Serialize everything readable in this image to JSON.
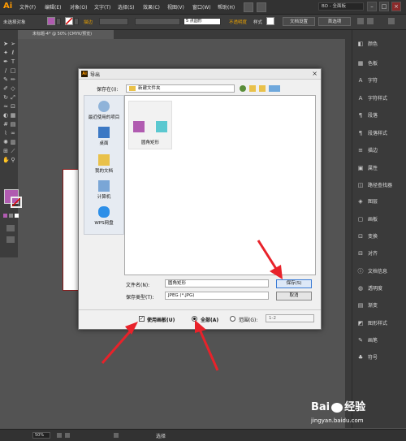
{
  "app": {
    "logo": "Ai"
  },
  "menubar": {
    "items": [
      "文件(F)",
      "编辑(E)",
      "对象(O)",
      "文字(T)",
      "选择(S)",
      "效果(C)",
      "视图(V)",
      "窗口(W)",
      "帮助(H)"
    ],
    "workspace": "BO - 全面板"
  },
  "controlbar": {
    "no_selection": "未选择对象",
    "stroke_label": "描边",
    "brush_value": "5 点圆形",
    "opacity_label": "不透明度",
    "style_label": "样式",
    "doc_setup": "文档设置",
    "preferences": "首选项"
  },
  "document": {
    "tab_title": "未标题-4* @ 50% (CMYK/预览)"
  },
  "right_panel": {
    "items": [
      "颜色",
      "色板",
      "字符",
      "字符样式",
      "段落",
      "段落样式",
      "描边",
      "属性",
      "路径查找器",
      "图层",
      "画板",
      "变换",
      "对齐",
      "文档信息",
      "透明度",
      "渐变",
      "图形样式",
      "画笔",
      "符号"
    ]
  },
  "statusbar": {
    "zoom": "50%",
    "tool": "选择"
  },
  "dialog": {
    "title": "导出",
    "save_in_label": "保存在(I):",
    "save_in_value": "新建文件夹",
    "places": [
      "最近使用的项目",
      "桌面",
      "我的文档",
      "计算机",
      "WPS网盘"
    ],
    "file_item": "圆角矩形",
    "filename_label": "文件名(N):",
    "filename_value": "圆角矩形",
    "filetype_label": "保存类型(T):",
    "filetype_value": "JPEG (*.JPG)",
    "save_button": "保存(S)",
    "cancel_button": "取消",
    "use_artboards": "使用画板(U)",
    "all_label": "全部(A)",
    "range_label": "范围(G):",
    "range_value": "1-2"
  },
  "watermark": {
    "brand": "Bai",
    "brand2": "经验",
    "url": "jingyan.baidu.com"
  },
  "colors": {
    "accent": "#ff9a00",
    "arrow": "#e8222a",
    "swatch_pink": "#b05bb0",
    "swatch_teal": "#5bc8d0"
  }
}
